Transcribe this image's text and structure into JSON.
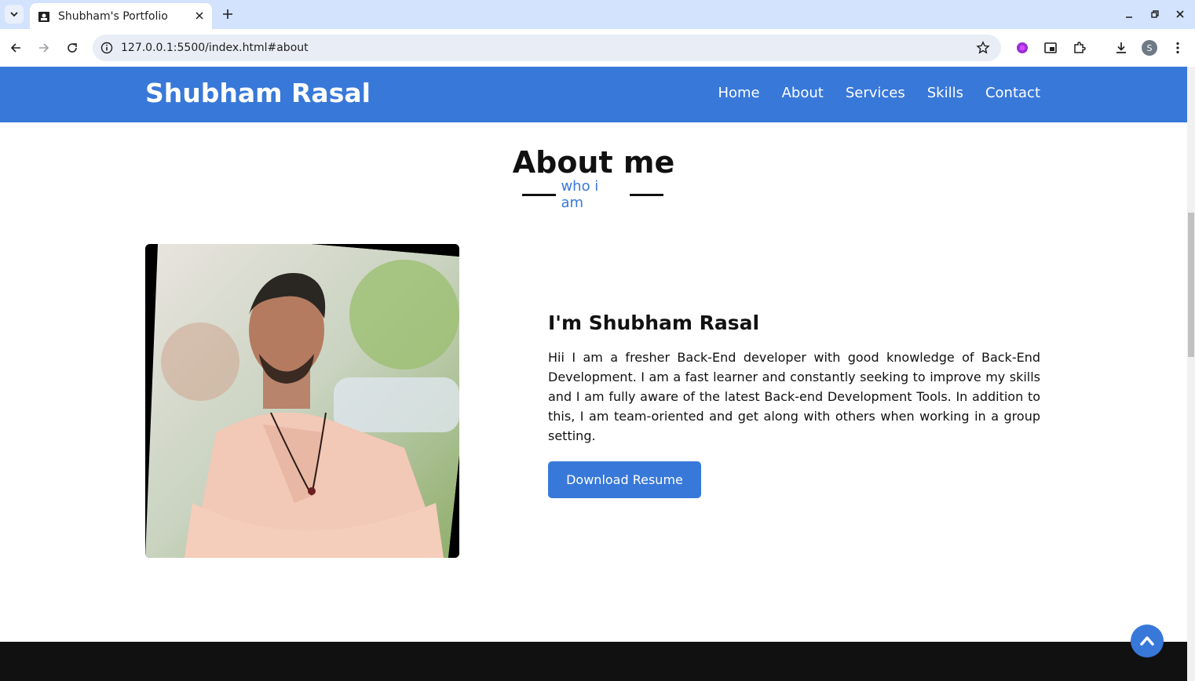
{
  "browser": {
    "tab_title": "Shubham's Portfolio",
    "url": "127.0.0.1:5500/index.html#about",
    "profile_initial": "S"
  },
  "site": {
    "brand": "Shubham Rasal",
    "nav": [
      "Home",
      "About",
      "Services",
      "Skills",
      "Contact"
    ],
    "accent_color": "#3878d9"
  },
  "about": {
    "title": "About me",
    "subtitle": "who i am",
    "heading": "I'm Shubham Rasal",
    "text": "Hii I am a fresher Back-End developer with good knowledge of Back-End Development. I am a fast learner and constantly seeking to improve my skills and I am fully aware of the latest Back-end Development Tools. In addition to this, I am team-oriented and get along with others when working in a group setting.",
    "button_label": "Download Resume"
  }
}
